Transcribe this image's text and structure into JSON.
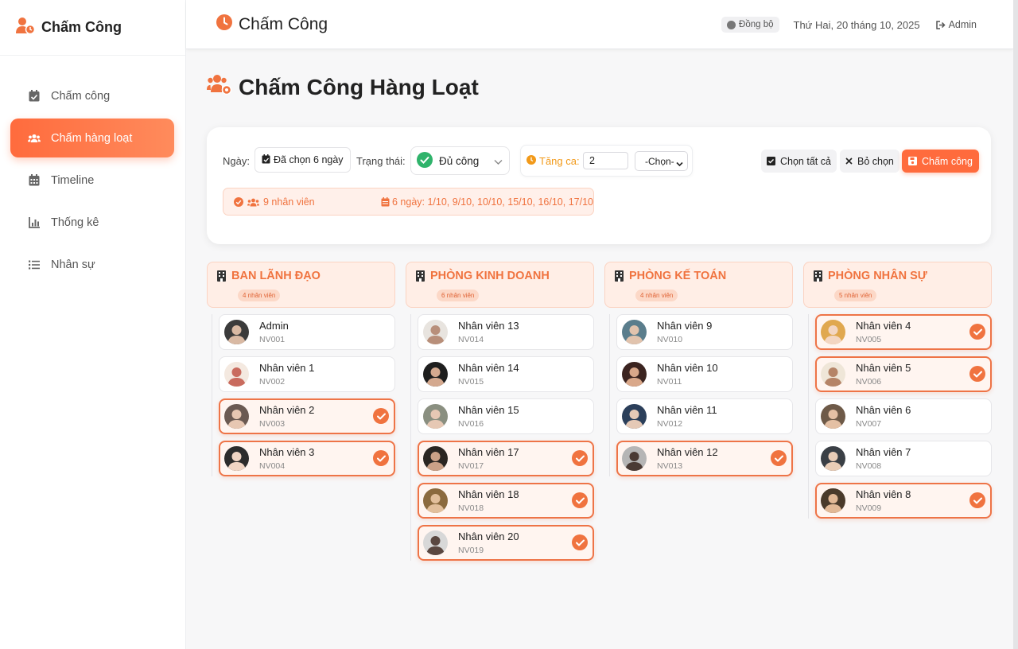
{
  "sidebar": {
    "brand": "Chấm Công",
    "items": [
      {
        "label": "Chấm công",
        "icon": "calendar-check-icon",
        "active": false
      },
      {
        "label": "Chấm hàng loạt",
        "icon": "users-icon",
        "active": true
      },
      {
        "label": "Timeline",
        "icon": "calendar-icon",
        "active": false
      },
      {
        "label": "Thống kê",
        "icon": "bar-chart-icon",
        "active": false
      },
      {
        "label": "Nhân sự",
        "icon": "list-icon",
        "active": false
      }
    ]
  },
  "topbar": {
    "title": "Chấm Công",
    "sync_label": "Đồng bộ",
    "date": "Thứ Hai, 20 tháng 10, 2025",
    "user": "Admin"
  },
  "page": {
    "title": "Chấm Công Hàng Loạt"
  },
  "filters": {
    "date_label": "Ngày:",
    "date_value": "Đã chọn 6 ngày",
    "status_label": "Trạng thái:",
    "status_value": "Đủ công",
    "overtime_label": "Tăng ca:",
    "overtime_value": "2",
    "overtime_select": "-Chọn-",
    "select_all": "Chọn tất cả",
    "clear": "Bỏ chọn",
    "submit": "Chấm công"
  },
  "summary": {
    "employees": "9 nhân viên",
    "days": "6 ngày: 1/10, 9/10, 10/10, 15/10, 16/10, 17/10"
  },
  "colors": {
    "accent": "#ff6b3d",
    "accent_text": "#f0733f",
    "success": "#2fb36b"
  },
  "departments": [
    {
      "name": "BAN LÃNH ĐẠO",
      "count": "4 nhân viên",
      "employees": [
        {
          "name": "Admin",
          "code": "NV001",
          "selected": false
        },
        {
          "name": "Nhân viên 1",
          "code": "NV002",
          "selected": false
        },
        {
          "name": "Nhân viên 2",
          "code": "NV003",
          "selected": true
        },
        {
          "name": "Nhân viên 3",
          "code": "NV004",
          "selected": true
        }
      ]
    },
    {
      "name": "PHÒNG KINH DOANH",
      "count": "6 nhân viên",
      "employees": [
        {
          "name": "Nhân viên 13",
          "code": "NV014",
          "selected": false
        },
        {
          "name": "Nhân viên 14",
          "code": "NV015",
          "selected": false
        },
        {
          "name": "Nhân viên 15",
          "code": "NV016",
          "selected": false
        },
        {
          "name": "Nhân viên 17",
          "code": "NV017",
          "selected": true
        },
        {
          "name": "Nhân viên 18",
          "code": "NV018",
          "selected": true
        },
        {
          "name": "Nhân viên 20",
          "code": "NV019",
          "selected": true
        }
      ]
    },
    {
      "name": "PHÒNG KẾ TOÁN",
      "count": "4 nhân viên",
      "employees": [
        {
          "name": "Nhân viên 9",
          "code": "NV010",
          "selected": false
        },
        {
          "name": "Nhân viên 10",
          "code": "NV011",
          "selected": false
        },
        {
          "name": "Nhân viên 11",
          "code": "NV012",
          "selected": false
        },
        {
          "name": "Nhân viên 12",
          "code": "NV013",
          "selected": true
        }
      ]
    },
    {
      "name": "PHÒNG NHÂN SỰ",
      "count": "5 nhân viên",
      "employees": [
        {
          "name": "Nhân viên 4",
          "code": "NV005",
          "selected": true
        },
        {
          "name": "Nhân viên 5",
          "code": "NV006",
          "selected": true
        },
        {
          "name": "Nhân viên 6",
          "code": "NV007",
          "selected": false
        },
        {
          "name": "Nhân viên 7",
          "code": "NV008",
          "selected": false
        },
        {
          "name": "Nhân viên 8",
          "code": "NV009",
          "selected": true
        }
      ]
    }
  ]
}
